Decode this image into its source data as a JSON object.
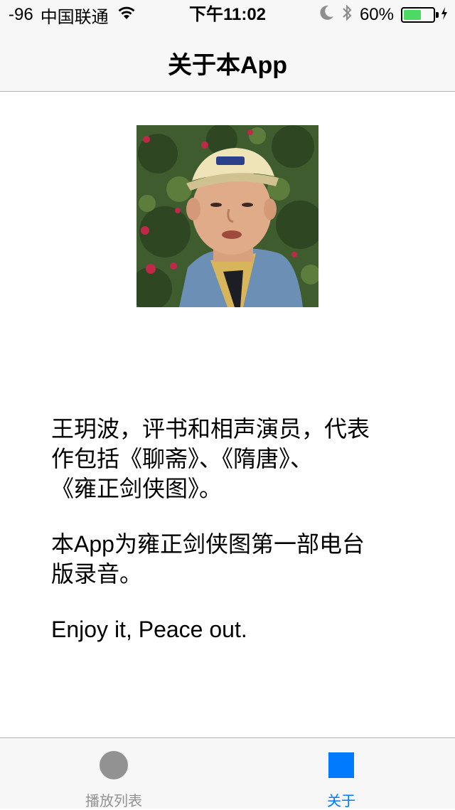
{
  "status_bar": {
    "signal": "-96",
    "carrier": "中国联通",
    "time": "下午11:02",
    "battery_percent": "60%",
    "battery_level": 0.6,
    "battery_color": "#4cd964"
  },
  "nav": {
    "title": "关于本App"
  },
  "about": {
    "photo_icon": "portrait-photo",
    "paragraph1": "王玥波，评书和相声演员，代表\n作包括《聊斋》、《隋唐》、\n《雍正剑侠图》。",
    "paragraph2": "本App为雍正剑侠图第一部电台\n版录音。",
    "paragraph3": "Enjoy it, Peace out."
  },
  "tab_bar": {
    "tabs": [
      {
        "label": "播放列表",
        "icon": "circle-icon",
        "selected": false
      },
      {
        "label": "关于",
        "icon": "square-icon",
        "selected": true
      }
    ],
    "selected_color": "#007aff",
    "unselected_color": "#929292"
  }
}
